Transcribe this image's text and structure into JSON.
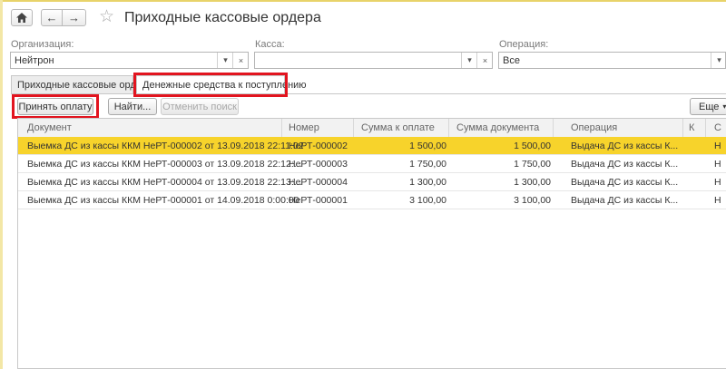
{
  "header": {
    "title": "Приходные кассовые ордера"
  },
  "filters": {
    "organization": {
      "label": "Организация:",
      "value": "Нейтрон"
    },
    "kassa": {
      "label": "Касса:",
      "value": ""
    },
    "operation": {
      "label": "Операция:",
      "value": "Все"
    }
  },
  "tabs": [
    {
      "label": "Приходные кассовые ордера"
    },
    {
      "label": "Денежные средства к поступлению"
    }
  ],
  "toolbar": {
    "accept_label": "Принять оплату",
    "find_label": "Найти...",
    "cancel_search_label": "Отменить поиск",
    "more_label": "Еще"
  },
  "table": {
    "columns": [
      "Документ",
      "Номер",
      "Сумма к оплате",
      "Сумма документа",
      "Операция",
      "К",
      "С"
    ],
    "rows": [
      {
        "doc": "Выемка ДС из кассы ККМ НеРТ-000002 от 13.09.2018 22:11:02",
        "num": "НеРТ-000002",
        "due": "1 500,00",
        "sum": "1 500,00",
        "op": "Выдача ДС из кассы К...",
        "k": "",
        "s": "Н"
      },
      {
        "doc": "Выемка ДС из кассы ККМ НеРТ-000003 от 13.09.2018 22:12:...",
        "num": "НеРТ-000003",
        "due": "1 750,00",
        "sum": "1 750,00",
        "op": "Выдача ДС из кассы К...",
        "k": "",
        "s": "Н"
      },
      {
        "doc": "Выемка ДС из кассы ККМ НеРТ-000004 от 13.09.2018 22:13:...",
        "num": "НеРТ-000004",
        "due": "1 300,00",
        "sum": "1 300,00",
        "op": "Выдача ДС из кассы К...",
        "k": "",
        "s": "Н"
      },
      {
        "doc": "Выемка ДС из кассы ККМ НеРТ-000001 от 14.09.2018 0:00:00",
        "num": "НеРТ-000001",
        "due": "3 100,00",
        "sum": "3 100,00",
        "op": "Выдача ДС из кассы К...",
        "k": "",
        "s": "Н"
      }
    ]
  },
  "colors": {
    "selected_row": "#f7d32b",
    "highlight_box": "#e2141f"
  }
}
